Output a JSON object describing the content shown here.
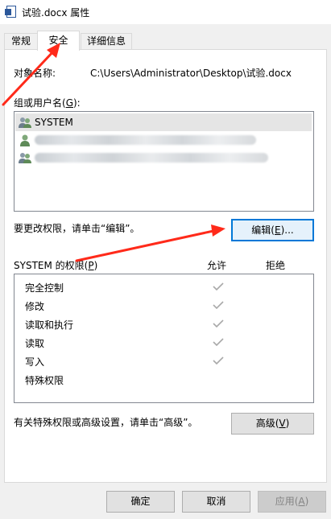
{
  "window": {
    "title": "试验.docx 属性"
  },
  "tabs": [
    {
      "label": "常规",
      "active": false
    },
    {
      "label": "安全",
      "active": true
    },
    {
      "label": "详细信息",
      "active": false
    }
  ],
  "object_name": {
    "label": "对象名称:",
    "value": "C:\\Users\\Administrator\\Desktop\\试验.docx"
  },
  "groups": {
    "label_prefix": "组或用户名(",
    "label_key": "G",
    "label_suffix": "):",
    "items": [
      {
        "name": "SYSTEM",
        "selected": true
      }
    ]
  },
  "edit_hint": "要更改权限，请单击“编辑”。",
  "edit_button": {
    "prefix": "编辑(",
    "key": "E",
    "suffix": ")..."
  },
  "permissions": {
    "title_prefix": "SYSTEM 的权限(",
    "title_key": "P",
    "title_suffix": ")",
    "allow_header": "允许",
    "deny_header": "拒绝",
    "rows": [
      {
        "name": "完全控制",
        "allow": true,
        "deny": false
      },
      {
        "name": "修改",
        "allow": true,
        "deny": false
      },
      {
        "name": "读取和执行",
        "allow": true,
        "deny": false
      },
      {
        "name": "读取",
        "allow": true,
        "deny": false
      },
      {
        "name": "写入",
        "allow": true,
        "deny": false
      },
      {
        "name": "特殊权限",
        "allow": false,
        "deny": false
      }
    ]
  },
  "advanced_hint": "有关特殊权限或高级设置，请单击“高级”。",
  "advanced_button": {
    "prefix": "高级(",
    "key": "V",
    "suffix": ")"
  },
  "footer": {
    "ok": "确定",
    "cancel": "取消",
    "apply_prefix": "应用(",
    "apply_key": "A",
    "apply_suffix": ")"
  },
  "colors": {
    "annotation_arrow": "#ff2a1a",
    "check_gray": "#a9a9a9",
    "focus_blue": "#0078d7"
  }
}
